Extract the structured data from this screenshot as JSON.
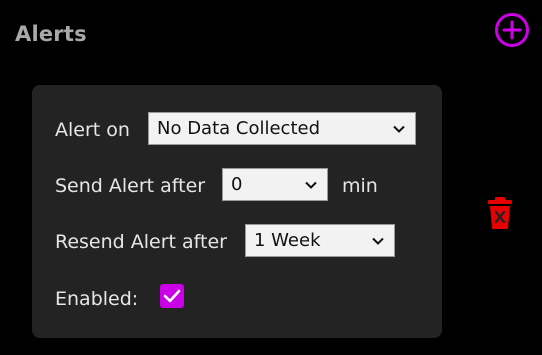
{
  "header": {
    "title": "Alerts",
    "add_icon": "plus-circle-icon"
  },
  "alert_card": {
    "alert_on": {
      "label": "Alert on",
      "selected": "No Data Collected"
    },
    "send_after": {
      "label": "Send Alert after",
      "selected": "0",
      "unit": "min"
    },
    "resend_after": {
      "label": "Resend Alert after",
      "selected": "1 Week"
    },
    "enabled": {
      "label": "Enabled:",
      "checked": true
    },
    "delete_icon": "trash-icon"
  },
  "colors": {
    "background": "#000000",
    "card": "#232323",
    "heading": "#a9a9a9",
    "accent": "#cc00e6",
    "danger": "#e60000"
  }
}
